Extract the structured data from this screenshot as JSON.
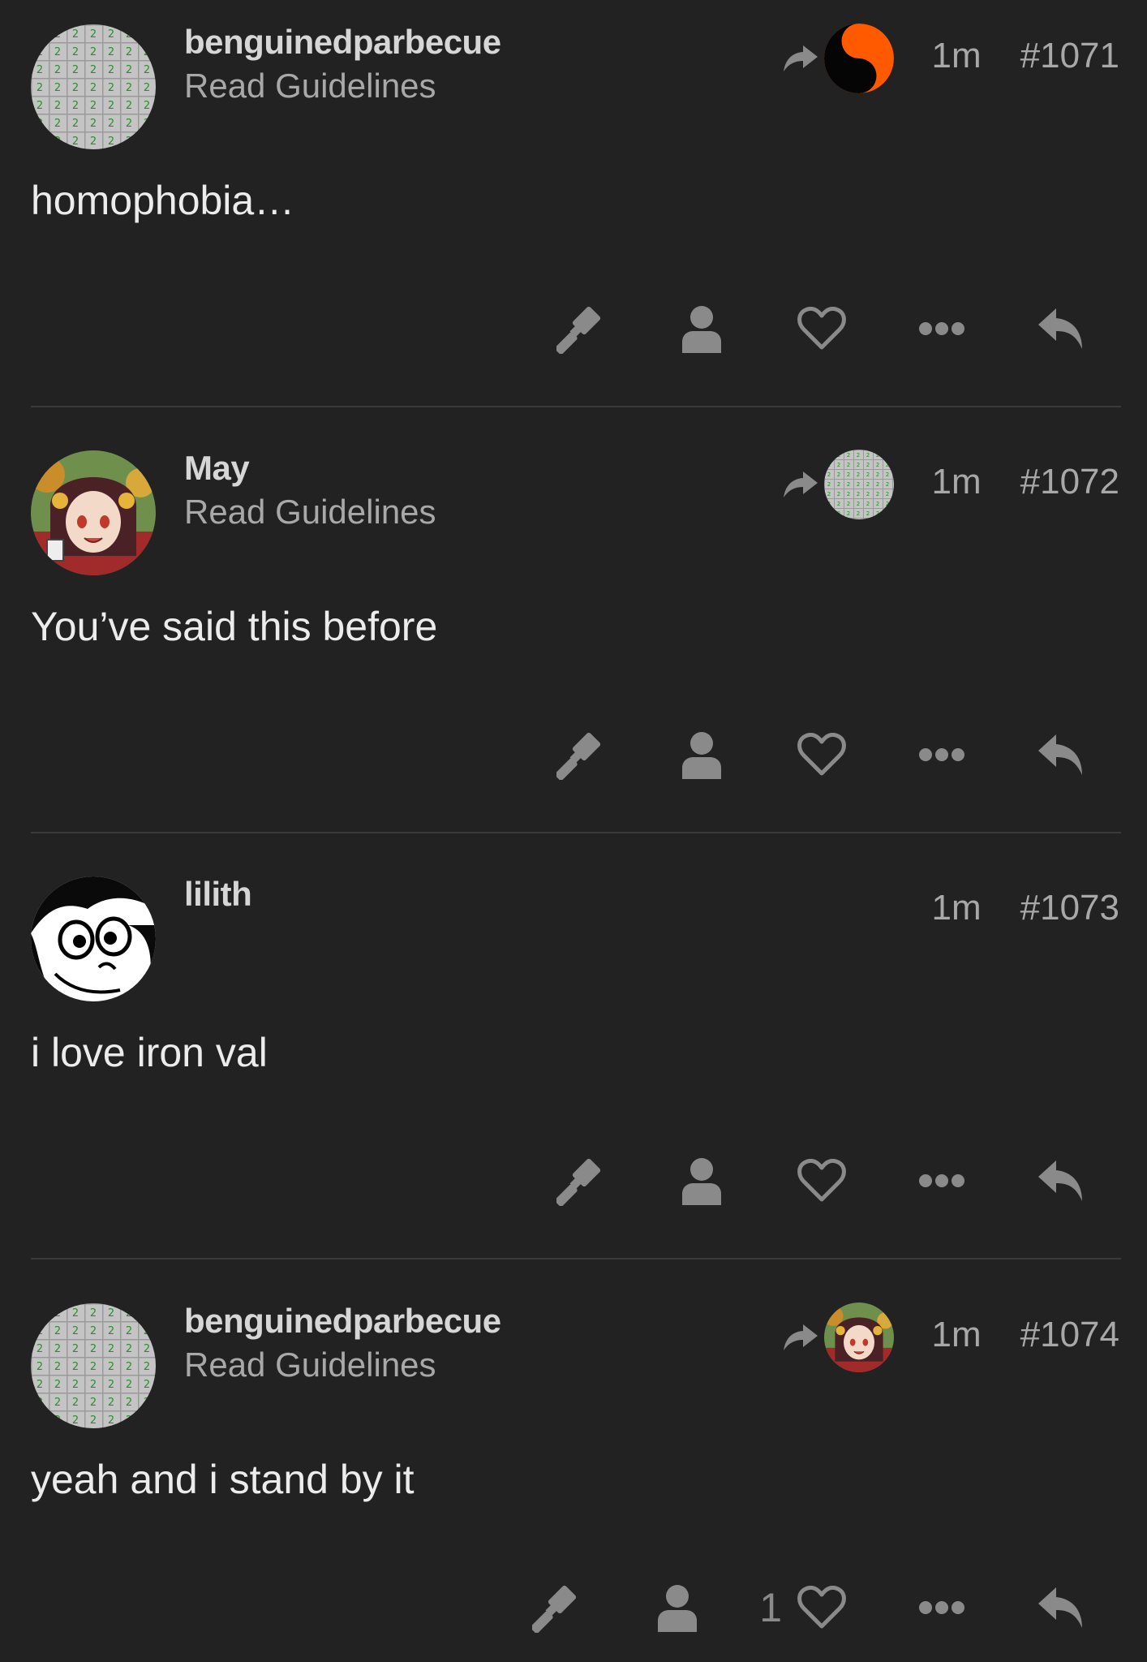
{
  "colors": {
    "background": "#222222",
    "divider": "#3a3a3a",
    "icon": "#8a8a8a",
    "username": "#d6d6d6",
    "secondary_text": "#a8a8a8",
    "body_text": "#ececec"
  },
  "posts": [
    {
      "username": "benguinedparbecue",
      "user_title": "Read Guidelines",
      "avatar": "minesweeper-grid-avatar",
      "reply_to_avatar": "yin-yang-avatar",
      "age": "1m",
      "post_number": "#1071",
      "body": "homophobia…",
      "like_count": "",
      "actions": [
        "gavel-icon",
        "user-icon",
        "heart-icon",
        "more-icon",
        "reply-icon"
      ]
    },
    {
      "username": "May",
      "user_title": "Read Guidelines",
      "avatar": "anime-girl-avatar",
      "reply_to_avatar": "minesweeper-grid-avatar",
      "age": "1m",
      "post_number": "#1072",
      "body": "You’ve said this before",
      "like_count": "",
      "actions": [
        "gavel-icon",
        "user-icon",
        "heart-icon",
        "more-icon",
        "reply-icon"
      ]
    },
    {
      "username": "lilith",
      "user_title": "",
      "avatar": "cartoon-face-avatar",
      "reply_to_avatar": "",
      "age": "1m",
      "post_number": "#1073",
      "body": "i love iron val",
      "like_count": "",
      "actions": [
        "gavel-icon",
        "user-icon",
        "heart-icon",
        "more-icon",
        "reply-icon"
      ]
    },
    {
      "username": "benguinedparbecue",
      "user_title": "Read Guidelines",
      "avatar": "minesweeper-grid-avatar",
      "reply_to_avatar": "anime-girl-avatar",
      "age": "1m",
      "post_number": "#1074",
      "body": "yeah and i stand by it",
      "like_count": "1",
      "actions": [
        "gavel-icon",
        "user-icon",
        "heart-icon",
        "more-icon",
        "reply-icon"
      ]
    }
  ]
}
